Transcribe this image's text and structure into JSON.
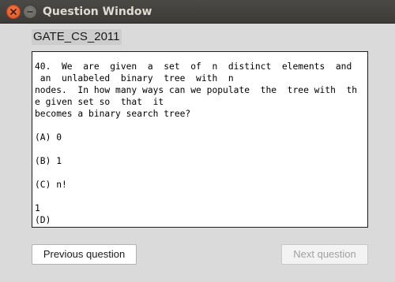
{
  "window": {
    "title": "Question Window",
    "controls": {
      "close_icon": "close-icon",
      "minimize_icon": "minimize-icon"
    }
  },
  "exam": {
    "label": "GATE_CS_2011"
  },
  "question": {
    "lines": [
      "40.  We  are  given  a  set  of  n  distinct  elements  and",
      " an  unlabeled  binary  tree  with  n",
      "nodes.  In how many ways can we populate  the  tree with  th",
      "e given set so  that  it",
      "becomes a binary search tree?",
      "",
      "(A) 0",
      "",
      "(B) 1",
      "",
      "(C) n!",
      "",
      "1",
      "(D)"
    ]
  },
  "buttons": {
    "previous": "Previous question",
    "next": "Next question"
  },
  "colors": {
    "titlebar": "#3c3b37",
    "close_button": "#e0521d",
    "window_bg": "#dadada",
    "disabled_text": "#a0a0a0"
  }
}
